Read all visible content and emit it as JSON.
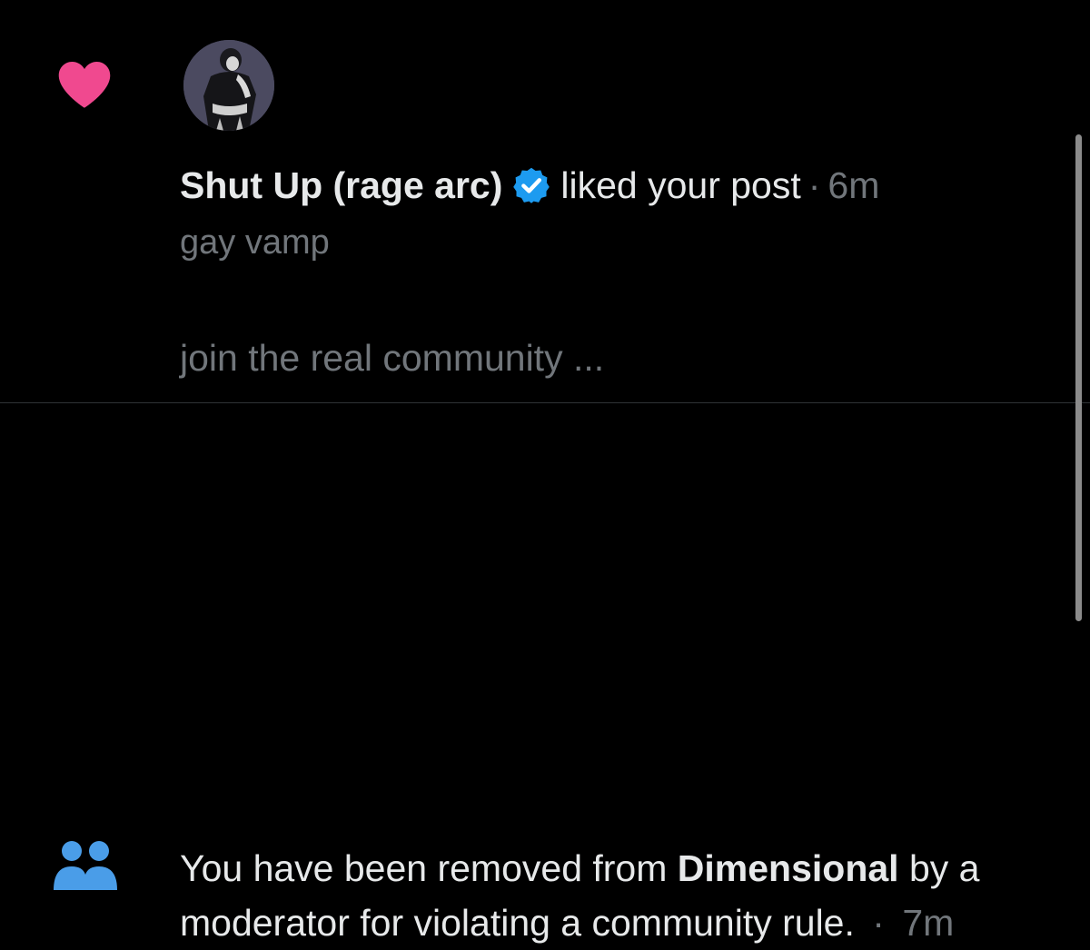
{
  "like_notification": {
    "user_name": "Shut Up (rage arc)",
    "action": "liked your post",
    "separator": "·",
    "time": "6m",
    "bio": "gay vamp",
    "post_preview": "join the real community ..."
  },
  "community_notification": {
    "text_before": "You have been removed from ",
    "community_name": "Dimensional",
    "text_after": " by a moderator for violating a community rule.",
    "separator": "·",
    "time": "7m"
  },
  "icons": {
    "like": "heart-icon",
    "community": "people-icon",
    "verified": "verified-badge-icon"
  },
  "colors": {
    "background": "#000000",
    "heart": "#f0498f",
    "community_icon": "#4a9de8",
    "verified": "#1d9bf0",
    "primary_text": "#e7e9ea",
    "secondary_text": "#71767b",
    "divider": "#2f3336"
  }
}
